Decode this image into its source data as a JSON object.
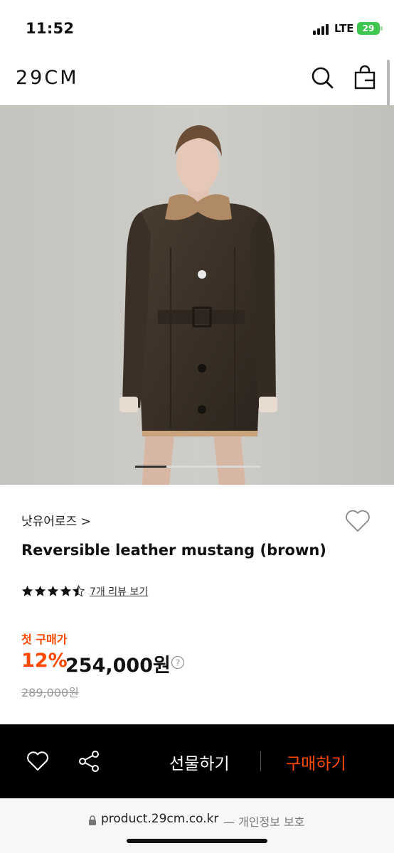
{
  "status_bar": {
    "time": "11:52",
    "network": "LTE",
    "battery": "29"
  },
  "header": {
    "logo": "29CM",
    "search_icon": "search-icon",
    "bag_icon": "shopping-bag-icon"
  },
  "hero": {
    "image_alt": "brown reversible leather mustang coat",
    "carousel_position": 0.25
  },
  "product": {
    "brand": "낫유어로즈",
    "brand_chevron": ">",
    "title": "Reversible leather mustang (brown)",
    "rating": 4.5,
    "review_link": "7개 리뷰 보기",
    "promo_label": "첫 구매가",
    "discount": "12%",
    "price": "254,000원",
    "help_icon": "?",
    "original_price": "289,000원",
    "wish_icon": "heart-outline-icon"
  },
  "action_bar": {
    "wish_icon": "heart-icon",
    "share_icon": "share-icon",
    "gift_label": "선물하기",
    "buy_label": "구매하기",
    "accent_color": "#ff4800"
  },
  "browser": {
    "url": "product.29cm.co.kr",
    "privacy": "— 개인정보 보호"
  }
}
